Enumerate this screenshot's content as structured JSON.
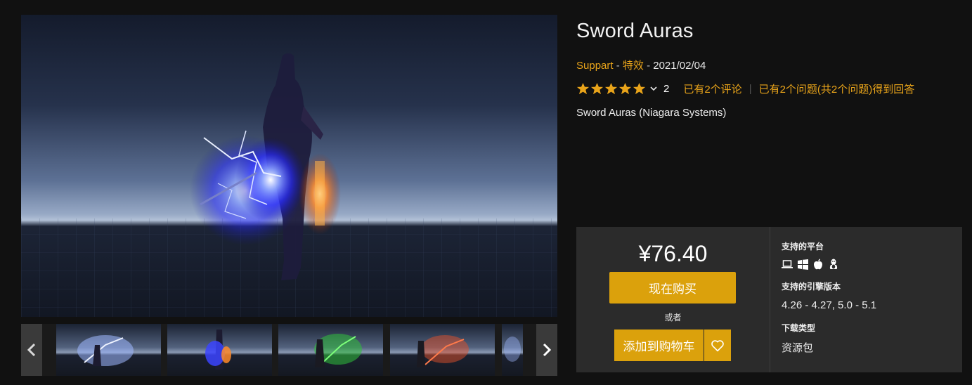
{
  "product": {
    "title": "Sword Auras",
    "seller": "Suppart",
    "category": "特效",
    "date": "2021/02/04",
    "meta_separator": " - ",
    "rating_count": "2",
    "reviews_link": "已有2个评论",
    "questions_link": "已有2个问题(共2个问题)得到回答",
    "subtitle": "Sword Auras (Niagara Systems)",
    "stars": 5
  },
  "purchase": {
    "price": "¥76.40",
    "buy_now": "现在购买",
    "or": "或者",
    "add_to_cart": "添加到购物车"
  },
  "details": {
    "platforms_label": "支持的平台",
    "platform_icons": [
      "laptop-icon",
      "windows-icon",
      "apple-icon",
      "linux-icon"
    ],
    "engine_label": "支持的引擎版本",
    "engine_versions": "4.26 - 4.27, 5.0 - 5.1",
    "download_label": "下载类型",
    "download_type": "资源包"
  },
  "gallery": {
    "thumbnail_count": 5,
    "thumbnail_glow_colors": [
      "#9fb8ff",
      "#3b44ff",
      "#2fbf3a",
      "#e0502a",
      "#9fb8ff"
    ]
  },
  "colors": {
    "accent": "#e9a41a",
    "button": "#dba10c",
    "background": "#111111",
    "panel": "#2b2b2b"
  }
}
